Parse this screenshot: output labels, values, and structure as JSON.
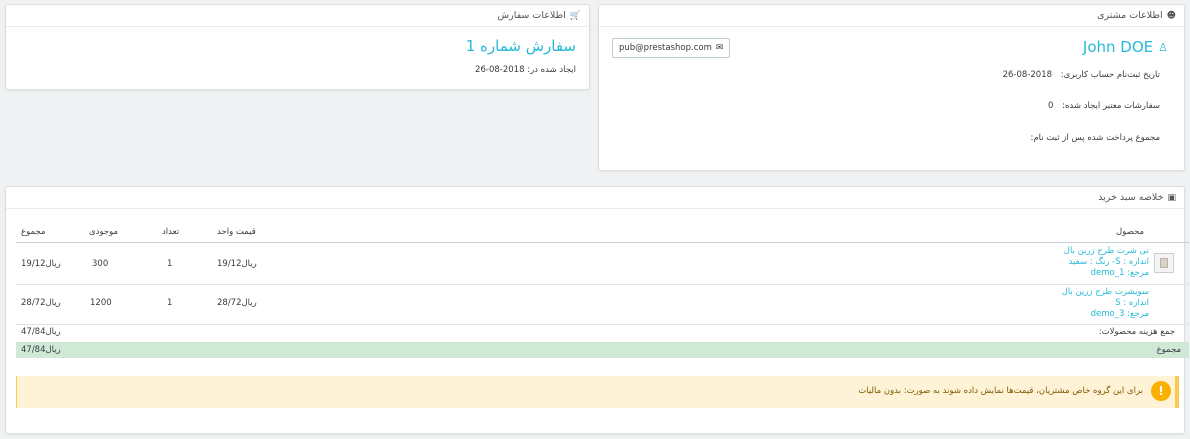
{
  "customer": {
    "heading": "اطلاعات مشتری",
    "name": "John DOE",
    "email": "pub@prestashop.com",
    "rows": [
      {
        "label": "تاریخ ثبت‌نام حساب کاربری:",
        "value": "2018-08-26"
      },
      {
        "label": "سفارشات معتبر ایجاد شده:",
        "value": "0"
      },
      {
        "label": "مجموع پرداخت شده پس از ثبت نام:",
        "value": ""
      }
    ]
  },
  "order": {
    "heading": "اطلاعات سفارش",
    "title": "سفارش شماره 1",
    "created_label": "ایجاد شده در:",
    "created_value": "2018-08-26"
  },
  "cart": {
    "heading": "خلاصه سبد خرید",
    "columns": {
      "product": "محصول",
      "unit_price": "قیمت واحد",
      "quantity": "تعداد",
      "stock": "موجودی",
      "total": "مجموع"
    },
    "rows": [
      {
        "name": "تی شرت طرح زرین بال",
        "attr": "اندازه : S- رنگ : سفید",
        "ref": "مرجع: demo_1",
        "unit_price": "ریال19/12",
        "quantity": "1",
        "stock": "300",
        "total": "ریال19/12"
      },
      {
        "name": "سویشرت طرح زرین بال",
        "attr": "اندازه : S",
        "ref": "مرجع: demo_3",
        "unit_price": "ریال28/72",
        "quantity": "1",
        "stock": "1200",
        "total": "ریال28/72"
      }
    ],
    "subtotal_label": "جمع هزینه محصولات:",
    "subtotal_value": "ریال47/84",
    "total_label": "مجموع",
    "total_value": "ریال47/84",
    "alert": "برای این گروه خاص مشتریان، قیمت‌ها نمایش داده شوند به صورت: بدون مالیات"
  },
  "icons": {
    "customer": "user-icon",
    "order": "cart-icon",
    "cart": "archive-icon",
    "gender": "male-icon",
    "email": "envelope-icon",
    "alert": "exclamation-icon"
  },
  "colors": {
    "accent": "#25b9d7",
    "total_row": "#cfe9d6",
    "alert_bg": "#fff3d7",
    "alert_icon": "#fab000"
  }
}
